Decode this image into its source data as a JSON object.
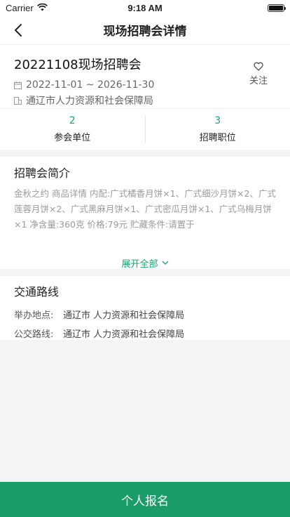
{
  "status": {
    "carrier": "Carrier",
    "time": "9:18 AM"
  },
  "nav": {
    "title": "现场招聘会详情"
  },
  "fair": {
    "title": "20221108现场招聘会",
    "date_range": "2022-11-01 ~ 2026-11-30",
    "organizer": "通辽市人力资源和社会保障局",
    "follow_label": "关注"
  },
  "stats": [
    {
      "value": "2",
      "label": "参会单位"
    },
    {
      "value": "3",
      "label": "招聘职位"
    }
  ],
  "intro": {
    "title": "招聘会简介",
    "text": "金秋之约 商品详情 内配:广式橘香月饼×1、广式细沙月饼×2、广式莲蓉月饼×2、广式黑麻月饼×1、广式密瓜月饼×1、广式乌梅月饼×1 净含量:360克 价格:79元 贮藏条件:请置于",
    "expand_label": "展开全部"
  },
  "route": {
    "title": "交通路线",
    "rows": [
      {
        "key": "举办地点:",
        "value": "通辽市 人力资源和社会保障局"
      },
      {
        "key": "公交路线:",
        "value": "通辽市 人力资源和社会保障局"
      }
    ]
  },
  "apply": {
    "label": "个人报名"
  },
  "colors": {
    "accent": "#1aa46f",
    "button": "#1a9c66"
  }
}
